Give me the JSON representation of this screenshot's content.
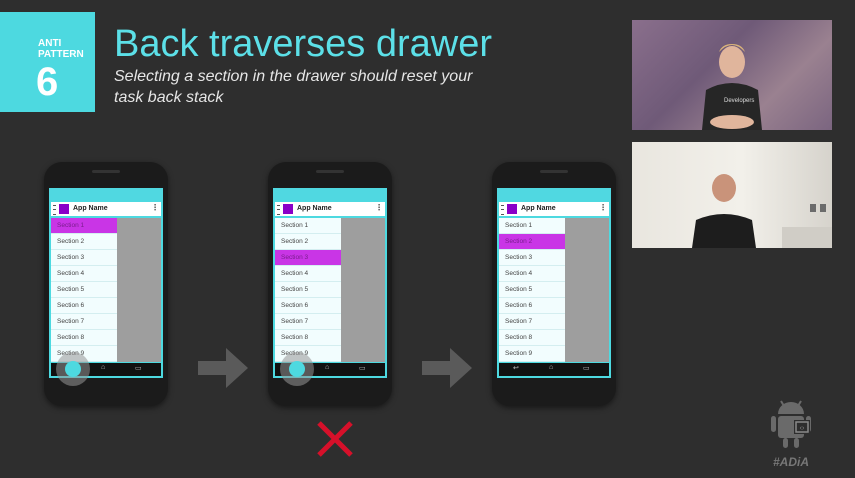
{
  "badge": {
    "line1": "ANTI",
    "line2": "PATTERN",
    "number": "6"
  },
  "title": "Back traverses drawer",
  "subtitle": "Selecting a section in the drawer should reset your task back stack",
  "phones": [
    {
      "app_name": "App Name",
      "selected": 0,
      "sections": [
        "Section 1",
        "Section 2",
        "Section 3",
        "Section 4",
        "Section 5",
        "Section 6",
        "Section 7",
        "Section 8",
        "Section 9"
      ]
    },
    {
      "app_name": "App Name",
      "selected": 2,
      "sections": [
        "Section 1",
        "Section 2",
        "Section 3",
        "Section 4",
        "Section 5",
        "Section 6",
        "Section 7",
        "Section 8",
        "Section 9"
      ]
    },
    {
      "app_name": "App Name",
      "selected": 1,
      "sections": [
        "Section 1",
        "Section 2",
        "Section 3",
        "Section 4",
        "Section 5",
        "Section 6",
        "Section 7",
        "Section 8",
        "Section 9"
      ]
    }
  ],
  "shirt_text": "Developers",
  "hashtag": "#ADiA",
  "colors": {
    "accent": "#4dd9e0",
    "selected": "#c935e6",
    "app_icon": "#8a00c8",
    "x_mark": "#d6102a",
    "arrow": "#5a5a5a"
  },
  "icons": [
    "hamburger-icon",
    "overflow-menu-icon",
    "back-icon",
    "home-icon",
    "recents-icon",
    "arrow-right-icon",
    "x-mark-icon",
    "android-logo-icon"
  ]
}
